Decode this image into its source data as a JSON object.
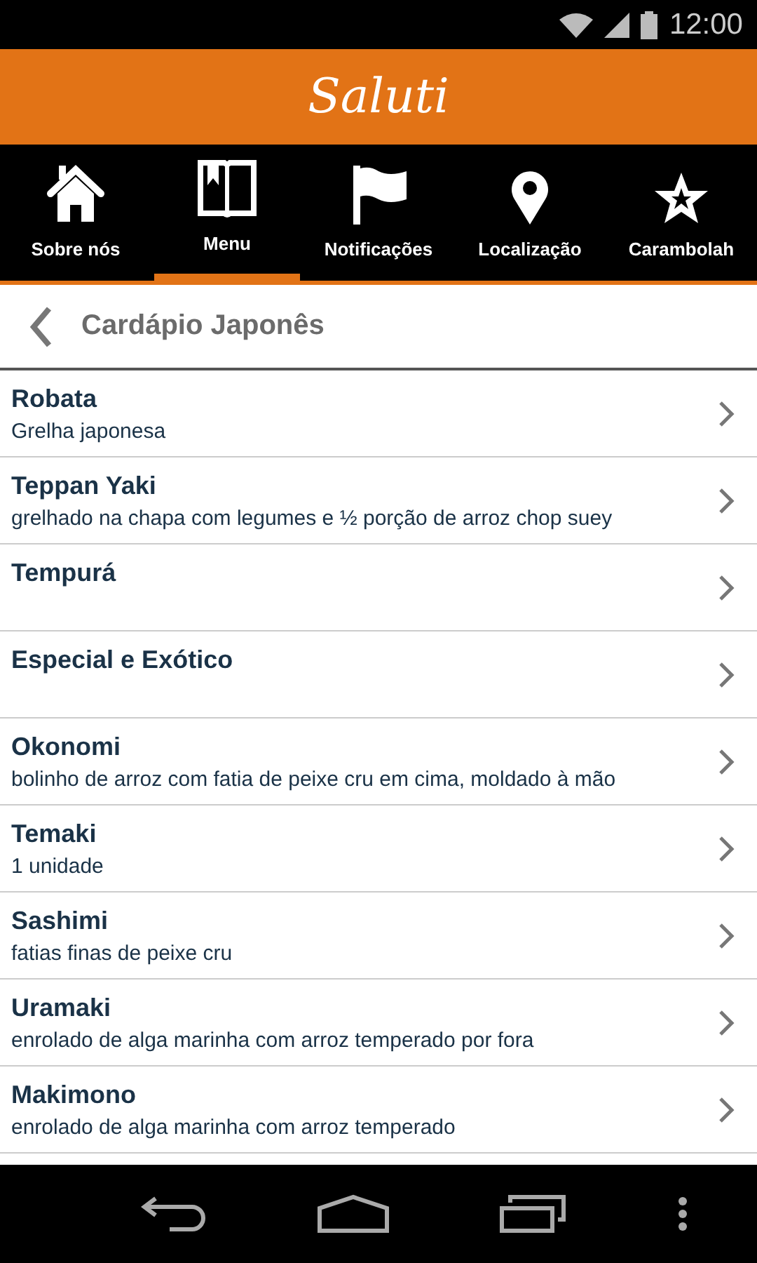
{
  "status_bar": {
    "time": "12:00"
  },
  "app_bar": {
    "title": "Saluti"
  },
  "tabs": [
    {
      "label": "Sobre nós",
      "selected": false
    },
    {
      "label": "Menu",
      "selected": true
    },
    {
      "label": "Notificações",
      "selected": false
    },
    {
      "label": "Localização",
      "selected": false
    },
    {
      "label": "Carambolah",
      "selected": false
    }
  ],
  "header": {
    "title": "Cardápio Japonês"
  },
  "items": [
    {
      "title": "Robata",
      "subtitle": "Grelha japonesa"
    },
    {
      "title": "Teppan Yaki",
      "subtitle": "grelhado na chapa com legumes e ½ porção de arroz chop suey"
    },
    {
      "title": "Tempurá"
    },
    {
      "title": "Especial e Exótico"
    },
    {
      "title": "Okonomi",
      "subtitle": "bolinho de arroz com fatia de peixe cru em cima, moldado à mão"
    },
    {
      "title": "Temaki",
      "subtitle": "1 unidade"
    },
    {
      "title": "Sashimi",
      "subtitle": "fatias finas de peixe cru"
    },
    {
      "title": "Uramaki",
      "subtitle": "enrolado de alga marinha com arroz temperado por fora"
    },
    {
      "title": "Makimono",
      "subtitle": "enrolado de alga marinha com arroz temperado"
    }
  ]
}
